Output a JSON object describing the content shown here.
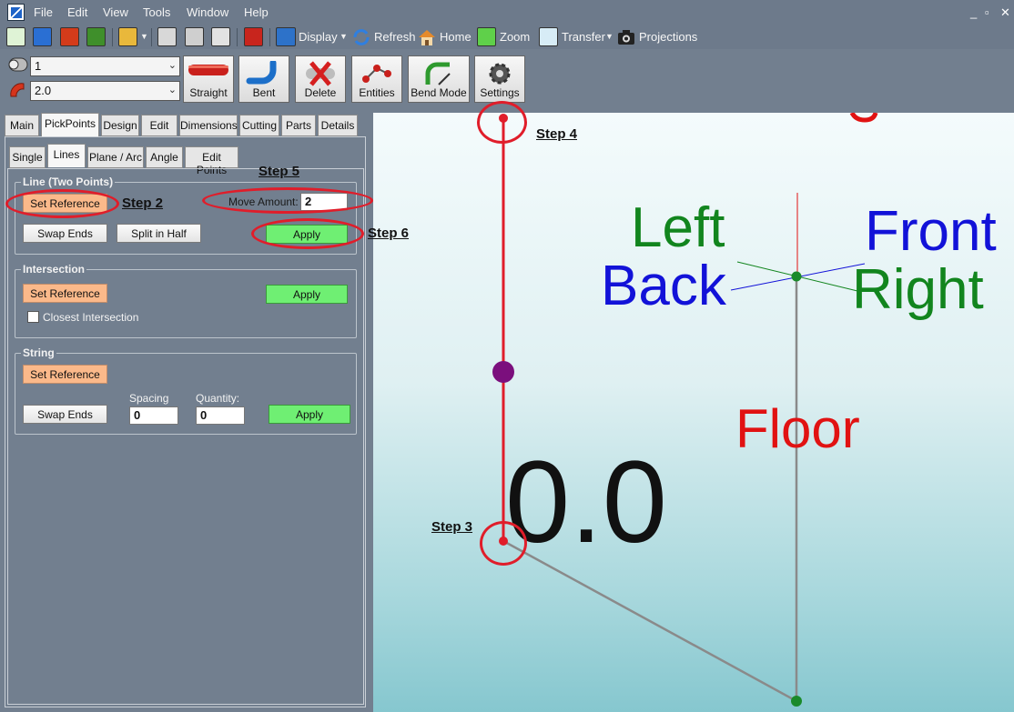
{
  "menu": [
    "File",
    "Edit",
    "View",
    "Tools",
    "Window",
    "Help"
  ],
  "window_controls": [
    "_",
    "▫",
    "✕"
  ],
  "toolbar1": {
    "display": "Display",
    "refresh": "Refresh",
    "home": "Home",
    "zoom": "Zoom",
    "transfer": "Transfer",
    "projections": "Projections"
  },
  "toolbar2": {
    "combo_top_value": "1",
    "combo_bottom_value": "2.0",
    "buttons": [
      "Straight",
      "Bent",
      "Delete",
      "Entities",
      "Bend Mode",
      "Settings"
    ]
  },
  "main_tabs": [
    "Main",
    "PickPoints",
    "Design",
    "Edit",
    "Dimensions",
    "Cutting",
    "Parts",
    "Details"
  ],
  "sub_tabs": [
    "Single",
    "Lines",
    "Plane / Arc",
    "Angle",
    "Edit Points"
  ],
  "line_group": {
    "title": "Line (Two Points)",
    "set_reference": "Set Reference",
    "move_amount_label": "Move Amount:",
    "move_amount_value": "2",
    "swap_ends": "Swap Ends",
    "split_in_half": "Split in Half",
    "apply": "Apply"
  },
  "intersection_group": {
    "title": "Intersection",
    "set_reference": "Set Reference",
    "apply": "Apply",
    "closest_intersection": "Closest Intersection"
  },
  "string_group": {
    "title": "String",
    "set_reference": "Set Reference",
    "swap_ends": "Swap Ends",
    "spacing_label": "Spacing",
    "spacing_value": "0",
    "quantity_label": "Quantity:",
    "quantity_value": "0",
    "apply": "Apply"
  },
  "annotations": {
    "step2": "Step 2",
    "step3": "Step 3",
    "step4": "Step 4",
    "step5": "Step 5",
    "step6": "Step 6"
  },
  "viewport": {
    "left": "Left",
    "back": "Back",
    "front": "Front",
    "right": "Right",
    "floor": "Floor",
    "value": "0.0"
  },
  "colors": {
    "orange_button": "#fbb98a",
    "green_button": "#6fef73",
    "annotation_red": "#e01d2a",
    "label_green": "#12851e",
    "label_blue": "#1212d8",
    "label_red": "#e11212"
  }
}
